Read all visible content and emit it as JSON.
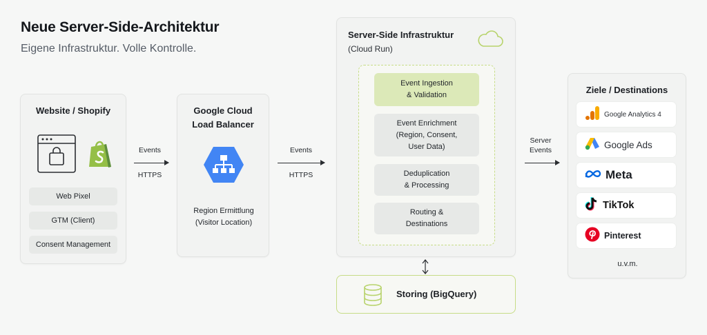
{
  "header": {
    "title": "Neue Server-Side-Architektur",
    "subtitle": "Eigene Infrastruktur. Volle Kontrolle."
  },
  "website": {
    "title": "Website / Shopify",
    "items": [
      "Web Pixel",
      "GTM (Client)",
      "Consent Management"
    ]
  },
  "arrow1": {
    "top": "Events",
    "bottom": "HTTPS"
  },
  "balancer": {
    "title_line1": "Google Cloud",
    "title_line2": "Load Balancer",
    "note_line1": "Region Ermittlung",
    "note_line2": "(Visitor Location)"
  },
  "arrow2": {
    "top": "Events",
    "bottom": "HTTPS"
  },
  "infra": {
    "title": "Server-Side Infrastruktur",
    "subtitle": "(Cloud Run)",
    "steps": [
      {
        "l1": "Event Ingestion",
        "l2": "& Validation",
        "l3": ""
      },
      {
        "l1": "Event Enrichment",
        "l2": "(Region, Consent,",
        "l3": "User Data)"
      },
      {
        "l1": "Deduplication",
        "l2": "& Processing",
        "l3": ""
      },
      {
        "l1": "Routing &",
        "l2": "Destinations",
        "l3": ""
      }
    ]
  },
  "storage": {
    "label": "Storing (BigQuery)"
  },
  "arrow3": {
    "top": "Server",
    "bottom": "Events"
  },
  "destinations": {
    "title": "Ziele / Destinations",
    "items": [
      "Google Analytics 4",
      "Google Ads",
      "Meta",
      "TikTok",
      "Pinterest"
    ],
    "more": "u.v.m."
  },
  "colors": {
    "accent_green": "#b7d36b",
    "step_green": "#dce9b8",
    "gcp_blue": "#4285f4",
    "shopify_green": "#95bf47"
  },
  "icons": [
    "browser-bag-icon",
    "shopify-icon",
    "load-balancer-icon",
    "cloud-icon",
    "database-icon",
    "ga4-icon",
    "google-ads-icon",
    "meta-icon",
    "tiktok-icon",
    "pinterest-icon"
  ]
}
